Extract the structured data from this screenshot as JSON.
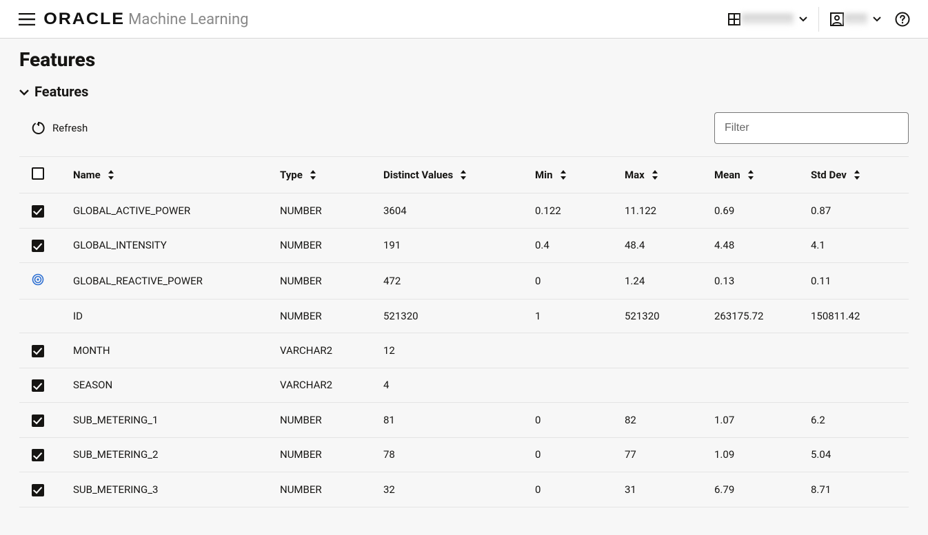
{
  "header": {
    "brand_main": "ORACLE",
    "brand_sub": "Machine Learning"
  },
  "page": {
    "title": "Features",
    "section_title": "Features"
  },
  "toolbar": {
    "refresh_label": "Refresh",
    "filter_placeholder": "Filter"
  },
  "columns": [
    {
      "label": "Name",
      "field": "name"
    },
    {
      "label": "Type",
      "field": "type"
    },
    {
      "label": "Distinct Values",
      "field": "distinct"
    },
    {
      "label": "Min",
      "field": "min"
    },
    {
      "label": "Max",
      "field": "max"
    },
    {
      "label": "Mean",
      "field": "mean"
    },
    {
      "label": "Std Dev",
      "field": "stddev"
    }
  ],
  "rows": [
    {
      "rowtype": "checked",
      "name": "GLOBAL_ACTIVE_POWER",
      "type": "NUMBER",
      "distinct": "3604",
      "min": "0.122",
      "max": "11.122",
      "mean": "0.69",
      "stddev": "0.87"
    },
    {
      "rowtype": "checked",
      "name": "GLOBAL_INTENSITY",
      "type": "NUMBER",
      "distinct": "191",
      "min": "0.4",
      "max": "48.4",
      "mean": "4.48",
      "stddev": "4.1"
    },
    {
      "rowtype": "target",
      "name": "GLOBAL_REACTIVE_POWER",
      "type": "NUMBER",
      "distinct": "472",
      "min": "0",
      "max": "1.24",
      "mean": "0.13",
      "stddev": "0.11"
    },
    {
      "rowtype": "none",
      "name": "ID",
      "type": "NUMBER",
      "distinct": "521320",
      "min": "1",
      "max": "521320",
      "mean": "263175.72",
      "stddev": "150811.42"
    },
    {
      "rowtype": "checked",
      "name": "MONTH",
      "type": "VARCHAR2",
      "distinct": "12",
      "min": "",
      "max": "",
      "mean": "",
      "stddev": ""
    },
    {
      "rowtype": "checked",
      "name": "SEASON",
      "type": "VARCHAR2",
      "distinct": "4",
      "min": "",
      "max": "",
      "mean": "",
      "stddev": ""
    },
    {
      "rowtype": "checked",
      "name": "SUB_METERING_1",
      "type": "NUMBER",
      "distinct": "81",
      "min": "0",
      "max": "82",
      "mean": "1.07",
      "stddev": "6.2"
    },
    {
      "rowtype": "checked",
      "name": "SUB_METERING_2",
      "type": "NUMBER",
      "distinct": "78",
      "min": "0",
      "max": "77",
      "mean": "1.09",
      "stddev": "5.04"
    },
    {
      "rowtype": "checked",
      "name": "SUB_METERING_3",
      "type": "NUMBER",
      "distinct": "32",
      "min": "0",
      "max": "31",
      "mean": "6.79",
      "stddev": "8.71"
    }
  ]
}
